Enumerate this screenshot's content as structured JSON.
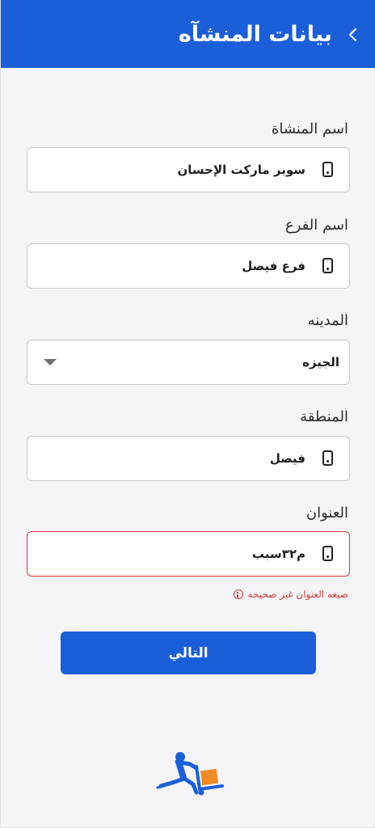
{
  "header": {
    "title": "بيانات المنشآه"
  },
  "form": {
    "facility_name": {
      "label": "اسم المنشاة",
      "value": "سوبر ماركت الإحسان"
    },
    "branch_name": {
      "label": "اسم الفرع",
      "value": "فرع فيصل"
    },
    "city": {
      "label": "المدينه",
      "value": "الجيزه"
    },
    "area": {
      "label": "المنطقة",
      "value": "فيصل"
    },
    "address": {
      "label": "العنوان",
      "value": "م٣٢سبب",
      "error": "صيغه العنوان غير صحيحه"
    }
  },
  "buttons": {
    "next": "التالي"
  },
  "colors": {
    "primary": "#1a5fd8",
    "error": "#d63a3a",
    "logo_accent": "#f08a24"
  },
  "icons": {
    "back": "chevron-left-icon",
    "field": "mobile-phone-icon",
    "dropdown": "caret-down-icon",
    "error": "info-circle-icon"
  }
}
